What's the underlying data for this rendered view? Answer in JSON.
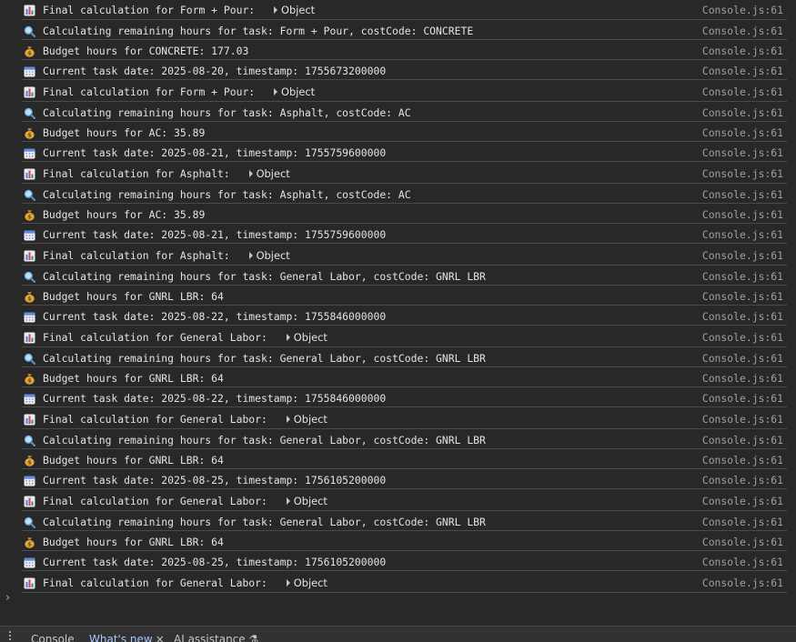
{
  "source": "Console.js:61",
  "log": [
    {
      "icon": "chart",
      "text": "Final calculation for Form + Pour: ",
      "object": "Object"
    },
    {
      "icon": "search",
      "text": "Calculating remaining hours for task: Form + Pour, costCode: CONCRETE"
    },
    {
      "icon": "money-bag",
      "text": "Budget hours for CONCRETE: 177.03"
    },
    {
      "icon": "calendar",
      "text": "Current task date: 2025-08-20, timestamp: 1755673200000"
    },
    {
      "icon": "chart",
      "text": "Final calculation for Form + Pour: ",
      "object": "Object"
    },
    {
      "icon": "search",
      "text": "Calculating remaining hours for task: Asphalt, costCode: AC"
    },
    {
      "icon": "money-bag",
      "text": "Budget hours for AC: 35.89"
    },
    {
      "icon": "calendar",
      "text": "Current task date: 2025-08-21, timestamp: 1755759600000"
    },
    {
      "icon": "chart",
      "text": "Final calculation for Asphalt: ",
      "object": "Object"
    },
    {
      "icon": "search",
      "text": "Calculating remaining hours for task: Asphalt, costCode: AC"
    },
    {
      "icon": "money-bag",
      "text": "Budget hours for AC: 35.89"
    },
    {
      "icon": "calendar",
      "text": "Current task date: 2025-08-21, timestamp: 1755759600000"
    },
    {
      "icon": "chart",
      "text": "Final calculation for Asphalt: ",
      "object": "Object"
    },
    {
      "icon": "search",
      "text": "Calculating remaining hours for task: General Labor, costCode: GNRL LBR"
    },
    {
      "icon": "money-bag",
      "text": "Budget hours for GNRL LBR: 64"
    },
    {
      "icon": "calendar",
      "text": "Current task date: 2025-08-22, timestamp: 1755846000000"
    },
    {
      "icon": "chart",
      "text": "Final calculation for General Labor: ",
      "object": "Object"
    },
    {
      "icon": "search",
      "text": "Calculating remaining hours for task: General Labor, costCode: GNRL LBR"
    },
    {
      "icon": "money-bag",
      "text": "Budget hours for GNRL LBR: 64"
    },
    {
      "icon": "calendar",
      "text": "Current task date: 2025-08-22, timestamp: 1755846000000"
    },
    {
      "icon": "chart",
      "text": "Final calculation for General Labor: ",
      "object": "Object"
    },
    {
      "icon": "search",
      "text": "Calculating remaining hours for task: General Labor, costCode: GNRL LBR"
    },
    {
      "icon": "money-bag",
      "text": "Budget hours for GNRL LBR: 64"
    },
    {
      "icon": "calendar",
      "text": "Current task date: 2025-08-25, timestamp: 1756105200000"
    },
    {
      "icon": "chart",
      "text": "Final calculation for General Labor: ",
      "object": "Object"
    },
    {
      "icon": "search",
      "text": "Calculating remaining hours for task: General Labor, costCode: GNRL LBR"
    },
    {
      "icon": "money-bag",
      "text": "Budget hours for GNRL LBR: 64"
    },
    {
      "icon": "calendar",
      "text": "Current task date: 2025-08-25, timestamp: 1756105200000"
    },
    {
      "icon": "chart",
      "text": "Final calculation for General Labor: ",
      "object": "Object"
    }
  ],
  "prompt_symbol": "›",
  "drawer": {
    "tabs": [
      {
        "label": "Console",
        "active": false
      },
      {
        "label": "What's new",
        "active": true,
        "closable": true,
        "close_symbol": "×"
      },
      {
        "label": "AI assistance",
        "active": false,
        "badge_symbol": "⚗"
      }
    ]
  },
  "colors": {
    "background": "#282828",
    "row_border": "#4a4a4a",
    "text": "#e3e3e3",
    "source_link": "#9aa0a6",
    "prompt": "#7cacf8",
    "active_tab": "#a8c7fa"
  }
}
